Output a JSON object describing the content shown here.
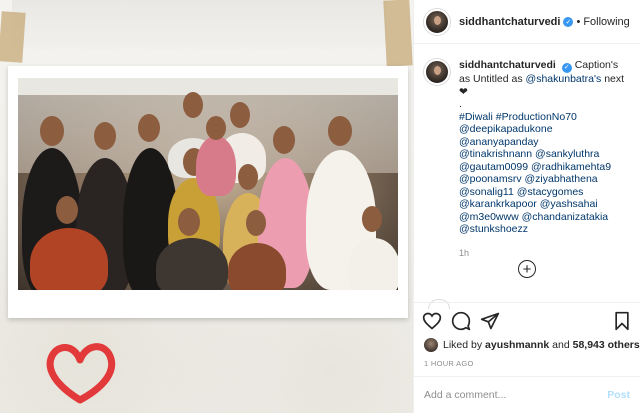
{
  "post": {
    "author": "siddhantchaturvedi",
    "follow_status": "Following",
    "dot": "•"
  },
  "caption": {
    "author": "siddhantchaturvedi",
    "text_pre": "Caption's as Untitled as",
    "mention": "@shakunbatra's",
    "text_post": "next",
    "heart": "❤",
    "separator": ".",
    "tags": [
      "#Diwali #ProductionNo70",
      "@deepikapadukone @ananyapanday",
      "@tinakrishnann @sankyluthra",
      "@gautam0099 @radhikamehta9",
      "@poonamsrv @ziyabhathena",
      "@sonalig11 @stacygomes",
      "@karankrkapoor @yashsahai",
      "@m3e0www @chandanizatakia",
      "@stunkshoezz"
    ],
    "time": "1h"
  },
  "likes": {
    "liked_by_prefix": "Liked by",
    "liked_by_user": "ayushmannk",
    "and": "and",
    "others_count": "58,943 others"
  },
  "date": "1 HOUR AGO",
  "comment_box": {
    "placeholder": "Add a comment...",
    "post_label": "Post"
  },
  "icons": {
    "like": "heart-outline-icon",
    "comment": "speech-bubble-icon",
    "share": "paper-plane-icon",
    "save": "bookmark-icon",
    "more": "plus-circle-icon"
  },
  "colors": {
    "link": "#00376b",
    "muted": "#8e8e8e",
    "verified": "#3897f0",
    "post_button": "#b2dffc",
    "heart_doodle": "#e23a3a"
  }
}
